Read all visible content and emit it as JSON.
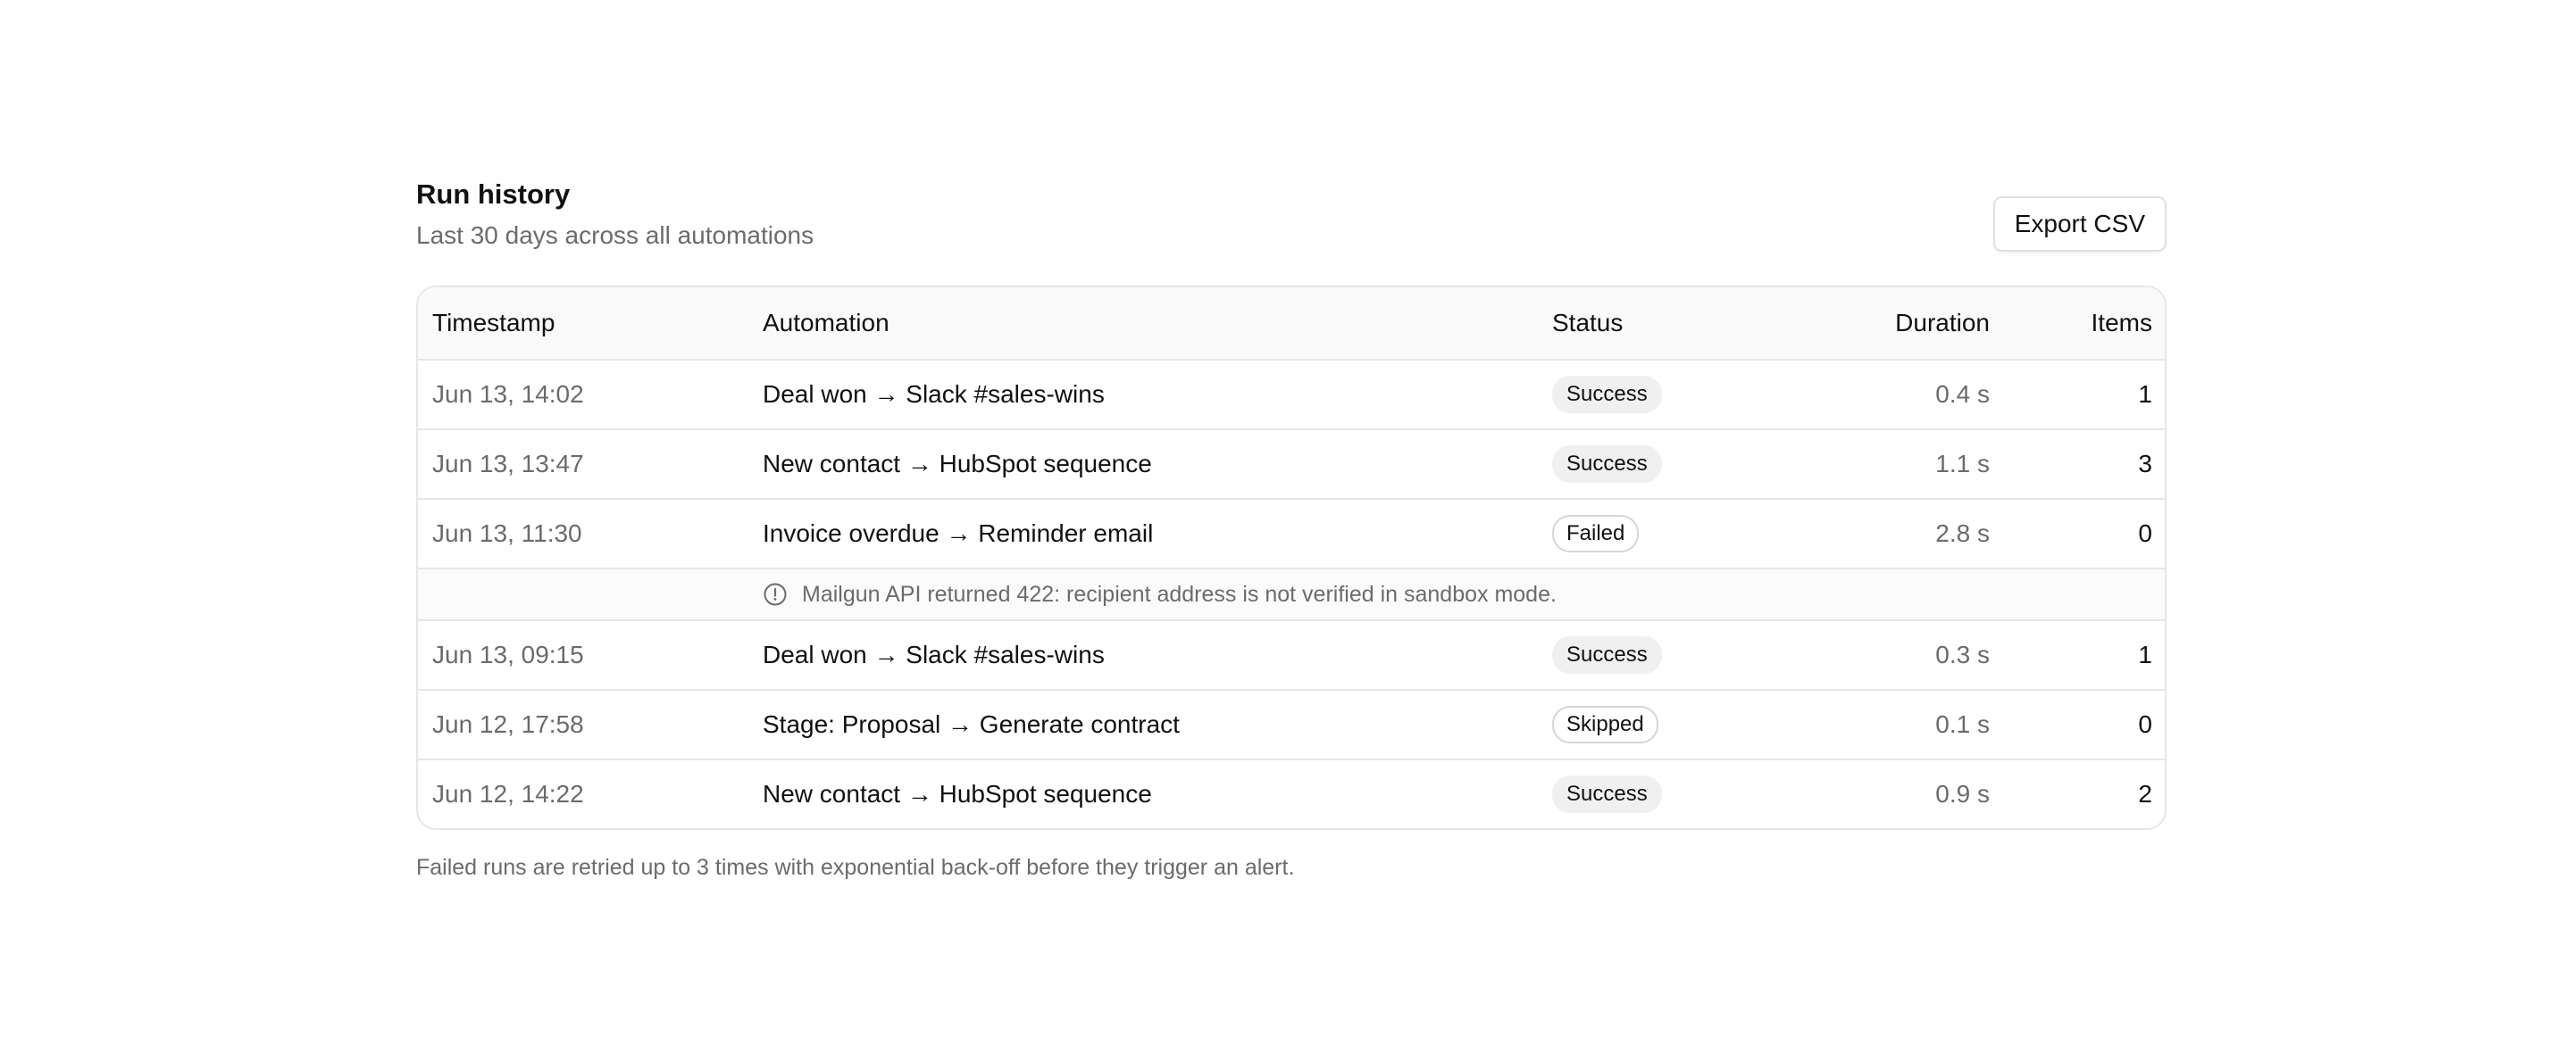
{
  "header": {
    "title": "Run history",
    "subtitle": "Last 30 days across all automations",
    "export_label": "Export CSV"
  },
  "table": {
    "columns": {
      "timestamp": "Timestamp",
      "automation": "Automation",
      "status": "Status",
      "duration": "Duration",
      "items": "Items"
    },
    "rows": [
      {
        "timestamp": "Jun 13, 14:02",
        "automation": "Deal won → Slack #sales-wins",
        "status": "Success",
        "duration": "0.4 s",
        "items": "1"
      },
      {
        "timestamp": "Jun 13, 13:47",
        "automation": "New contact → HubSpot sequence",
        "status": "Success",
        "duration": "1.1 s",
        "items": "3"
      },
      {
        "timestamp": "Jun 13, 11:30",
        "automation": "Invoice overdue → Reminder email",
        "status": "Failed",
        "duration": "2.8 s",
        "items": "0"
      },
      {
        "timestamp": "Jun 13, 09:15",
        "automation": "Deal won → Slack #sales-wins",
        "status": "Success",
        "duration": "0.3 s",
        "items": "1"
      },
      {
        "timestamp": "Jun 12, 17:58",
        "automation": "Stage: Proposal → Generate contract",
        "status": "Skipped",
        "duration": "0.1 s",
        "items": "0"
      },
      {
        "timestamp": "Jun 12, 14:22",
        "automation": "New contact → HubSpot sequence",
        "status": "Success",
        "duration": "0.9 s",
        "items": "2"
      }
    ],
    "error_message": "Mailgun API returned 422: recipient address is not verified in sandbox mode.",
    "error_icon": "alert-circle-icon"
  },
  "footnote": "Failed runs are retried up to 3 times with exponential back-off before they trigger an alert."
}
